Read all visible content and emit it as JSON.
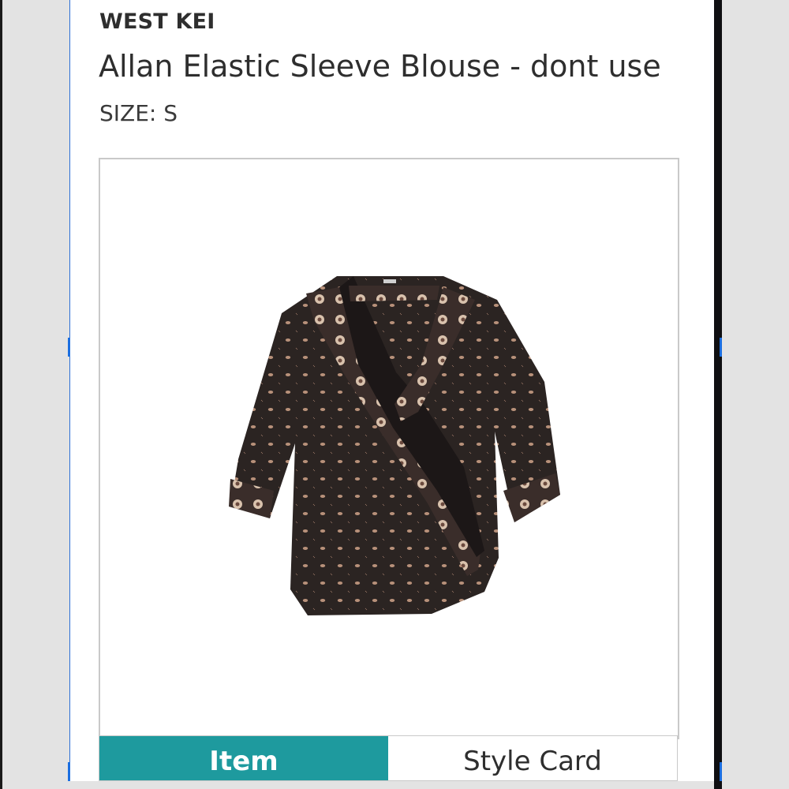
{
  "product": {
    "brand": "WEST KEI",
    "title": "Allan Elastic Sleeve Blouse - dont use",
    "size": "SIZE: S",
    "image_label": "Allan Elastic Sleeve Blouse product photo"
  },
  "tabs": [
    {
      "label": "Item",
      "active": true
    },
    {
      "label": "Style Card",
      "active": false
    }
  ],
  "colors": {
    "accent": "#1e9a9e",
    "selection_border": "#2b6fd6",
    "garment": "#2b2422",
    "trim": "#cfae96"
  }
}
